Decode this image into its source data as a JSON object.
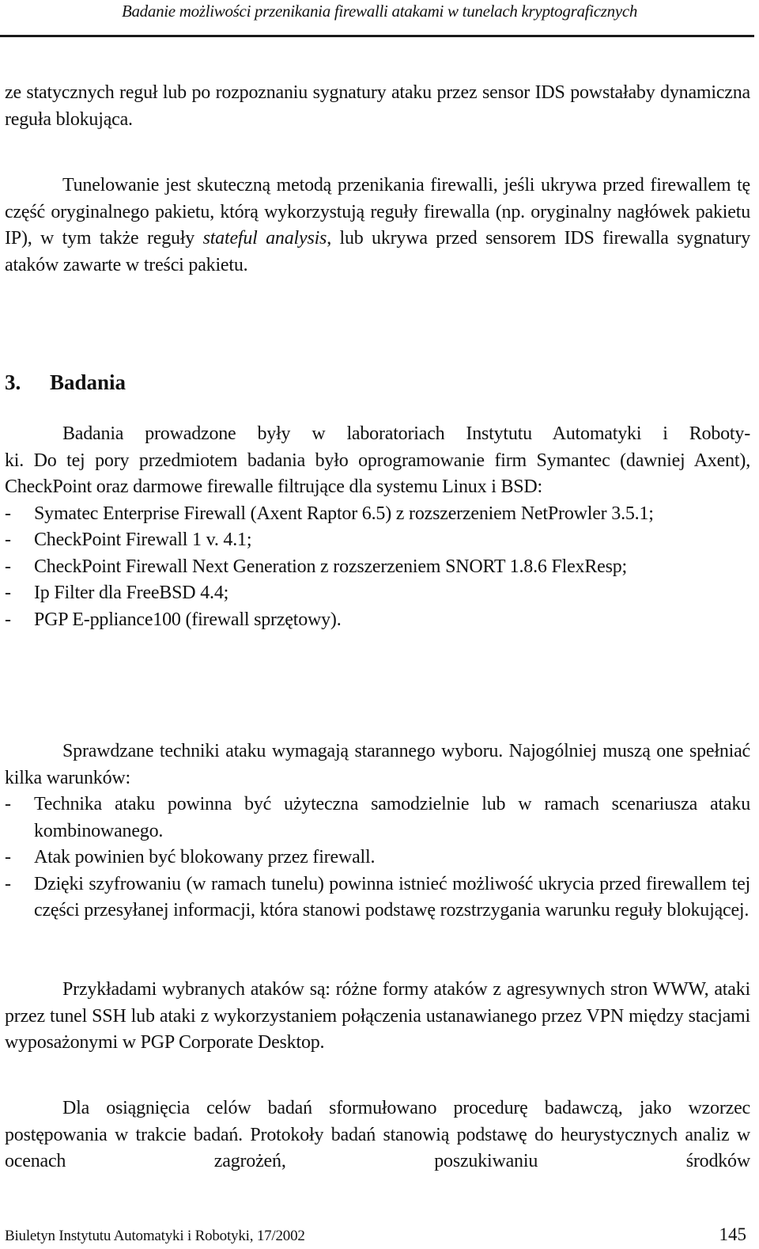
{
  "header": {
    "running_title": "Badanie możliwości przenikania firewalli atakami w tunelach kryptograficznych"
  },
  "continuation": {
    "text": "ze statycznych reguł lub po rozpoznaniu sygnatury ataku przez sensor IDS powstałaby dynamiczna reguła blokująca."
  },
  "tunneling_paragraph": {
    "before_italic_1": "Tunelowanie jest skuteczną metodą przenikania firewalli, jeśli ukrywa przed firewallem tę część oryginalnego pakietu, którą wykorzystują reguły firewalla (np. oryginalny nagłówek pakietu IP), w tym także reguły ",
    "italic_1": "stateful analysis",
    "after_italic_1": ", lub ukrywa przed sensorem IDS firewalla sygnatury ataków zawarte w treści pakietu."
  },
  "section": {
    "number": "3.",
    "title": "Badania"
  },
  "research_paragraph": {
    "text": "Badania prowadzone były w laboratoriach Instytutu Automatyki i Robotyki. Do tej pory przedmiotem badania było oprogramowanie firm Symantec (dawniej Axent), CheckPoint oraz darmowe firewalle filtrujące dla systemu Linux i BSD:",
    "line1": "Badania prowadzone były w laboratoriach Instytutu Automatyki i Roboty-",
    "rest": "ki. Do tej pory przedmiotem badania było oprogramowanie firm Symantec (dawniej Axent), CheckPoint oraz darmowe firewalle filtrujące dla systemu Linux i BSD:"
  },
  "products_list": {
    "bullet": "-",
    "items": [
      "Symatec Enterprise Firewall (Axent Raptor 6.5) z rozszerzeniem NetProwler 3.5.1;",
      "CheckPoint Firewall 1 v. 4.1;",
      "CheckPoint Firewall Next Generation z rozszerzeniem SNORT 1.8.6 FlexResp;",
      "Ip Filter dla FreeBSD 4.4;",
      "PGP E-ppliance100 (firewall sprzętowy)."
    ]
  },
  "techniques_paragraph": {
    "text": "Sprawdzane techniki ataku wymagają starannego wyboru. Najogólniej muszą one spełniać kilka warunków:"
  },
  "conditions_list": {
    "bullet": "-",
    "items": [
      "Technika ataku powinna być użyteczna samodzielnie lub w ramach scenariusza ataku kombinowanego.",
      "Atak powinien być blokowany przez firewall.",
      "Dzięki szyfrowaniu (w ramach tunelu) powinna istnieć możliwość ukrycia przed firewallem tej części przesyłanej informacji, która stanowi podstawę rozstrzygania warunku reguły blokującej."
    ]
  },
  "examples_paragraph": {
    "text": "Przykładami wybranych ataków są: różne formy ataków z agresywnych stron WWW, ataki przez tunel SSH lub ataki z wykorzystaniem połączenia ustanawianego przez VPN między stacjami wyposażonymi w PGP Corporate Desktop."
  },
  "procedure_paragraph": {
    "text": "Dla osiągnięcia celów badań sformułowano procedurę badawczą, jako wzorzec postępowania w trakcie badań. Protokoły badań stanowią podstawę do heurystycznych analiz w ocenach zagrożeń, poszukiwaniu środków"
  },
  "footer": {
    "journal": "Biuletyn Instytutu Automatyki i Robotyki, 17/2002",
    "page_number": "145"
  }
}
